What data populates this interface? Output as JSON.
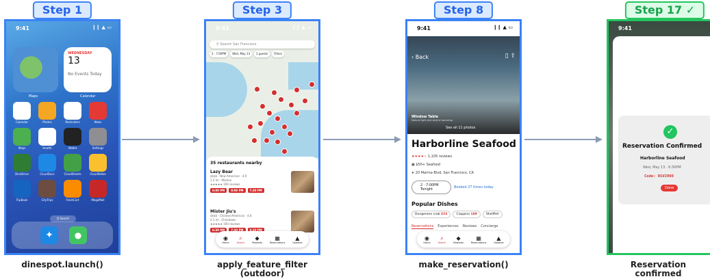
{
  "steps": [
    {
      "badge": "Step 1",
      "caption": "dinespot.launch()"
    },
    {
      "badge": "Step 3",
      "caption": "apply_feature_filter\n(outdoor)"
    },
    {
      "badge": "Step 8",
      "caption": "make_reservation()"
    },
    {
      "badge": "Step 17 ✓",
      "caption": "Reservation\nconfirmed"
    }
  ],
  "colors": {
    "blue": "#3b82f6",
    "green": "#22c55e",
    "red": "#d32f2f"
  },
  "home": {
    "time": "9:41",
    "status_icons": "❙❙ ▲ ▭",
    "calendar_weekday": "WEDNESDAY",
    "calendar_day": "13",
    "calendar_events": "No Events Today",
    "maps_label": "Maps",
    "calendar_label": "Calendar",
    "apps": [
      "Calendar",
      "Photos",
      "Reminders",
      "News",
      "Maps",
      "Health",
      "Wallet",
      "Settings",
      "DineDrive",
      "CloudDocs",
      "CloudSheets",
      "CloudSlides",
      "TripBook",
      "CityTrips",
      "FreshCart",
      "MegaMall"
    ],
    "search": "Q Search"
  },
  "map": {
    "time": "9:41",
    "status_icons": "❙❙ ▲ ▭",
    "search_placeholder": "Search San Francisco",
    "chips": [
      "2 · 7:00PM",
      "Wed, May 13",
      "2 guests",
      "Filters"
    ],
    "sheet_title": "35 restaurants nearby",
    "restaurants": [
      {
        "name": "Lazy Bear",
        "meta1": "$$$$ · New American · 4.9",
        "meta2": "1.2 mi · Mission",
        "meta3": "★★★★★ 100 reviews",
        "slots": [
          "6:00 PM",
          "8:00 PM",
          "7:30 PM"
        ]
      },
      {
        "name": "Mister Jiu's",
        "meta1": "$$$$ · Chinese-American · 4.8",
        "meta2": "2.1 mi · Chinatown",
        "meta3": "★★★★★ 100 reviews",
        "slots": [
          "6:30 PM",
          "7:30 PM",
          "8:30 PM"
        ]
      }
    ],
    "tabs": [
      "Home",
      "Search",
      "Rewards",
      "Reservations",
      "Updates"
    ]
  },
  "detail": {
    "time": "9:41",
    "status_icons": "❙❙ ▲ ▭",
    "back": "‹ Back",
    "caption_title": "Window Table",
    "caption_sub": "Natural light and skyline backdrop",
    "see_all": "See all 11 photos",
    "name": "Harborline Seafood",
    "stars": "★★★★☆",
    "reviews": "1,105 reviews",
    "price": "$50+  Seafood",
    "address": "20 Marina Blvd, San Francisco, CA",
    "time_box": "2 · 7:00PM",
    "time_box2": "Tonight",
    "booked": "Booked 27 times today",
    "popular": "Popular Dishes",
    "dishes": [
      {
        "name": "Dungeness crab",
        "count": "223"
      },
      {
        "name": "Cioppino",
        "count": "169"
      },
      {
        "name": "Shellfish",
        "count": ""
      }
    ],
    "tabs": [
      "Reservations",
      "Experiences",
      "Reviews",
      "Concierge"
    ]
  },
  "confirm": {
    "time": "9:41",
    "title": "Reservation Confirmed",
    "restaurant": "Harborline Seafood",
    "datetime": "Wed, May 13 · 6:30PM",
    "code": "Code: RSV2008",
    "done": "Done"
  }
}
